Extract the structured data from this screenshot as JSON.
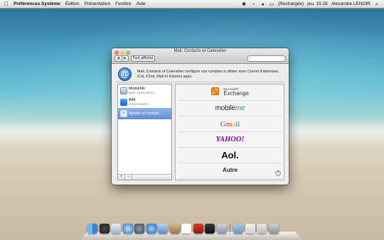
{
  "menubar": {
    "apple": "",
    "app_name": "Préférences Système",
    "menus": [
      "Édition",
      "Présentation",
      "Fenêtre",
      "Aide"
    ],
    "battery_status": "(Rechargée)",
    "clock": "jeu. 15:26",
    "user": "Alexandre LENOIR"
  },
  "window": {
    "title": "Mail, Contacts et Calendrier",
    "show_all_label": "Tout afficher",
    "nav_back": "◀",
    "nav_forward": "▶",
    "search_placeholder": "",
    "header_text": "Mail, Contacts et Calendrier configure vos comptes à utiliser avec Carnet d'adresses, iCal, iChat, Mail et d'autres apps.",
    "header_icon": "@"
  },
  "accounts": [
    {
      "name": "MobileMe",
      "sub": "Mail, Calendriers",
      "icon": "mobileme-icon"
    },
    {
      "name": "AIM",
      "sub": "Conversation",
      "icon": "aim-icon"
    },
    {
      "name": "Ajouter un compte...",
      "sub": "",
      "icon": "add-account-icon"
    }
  ],
  "list_buttons": {
    "add": "+",
    "remove": "−"
  },
  "providers": {
    "exchange_small": "Microsoft®",
    "exchange_big": "Exchange",
    "mobileme_prefix": "mobile",
    "mobileme_suffix": "me",
    "gmail": "Gmail",
    "yahoo": "YAHOO!",
    "aol": "Aol.",
    "other": "Autre"
  },
  "help_label": "?",
  "colors": {
    "selection": "#5f8fd0",
    "yahoo": "#7b0099",
    "mobileme_accent": "#2b82d9"
  },
  "dock": {
    "icons": [
      "finder-icon",
      "dashboard-icon",
      "mail-icon",
      "safari-icon",
      "system-preferences-icon",
      "itunes-icon",
      "iphoto-icon",
      "address-book-icon",
      "calendar-icon",
      "photo-booth-icon",
      "quicktime-icon",
      "preferences-icon",
      "downloads-stack-icon",
      "documents-stack-icon",
      "applications-stack-icon",
      "trash-icon"
    ]
  }
}
